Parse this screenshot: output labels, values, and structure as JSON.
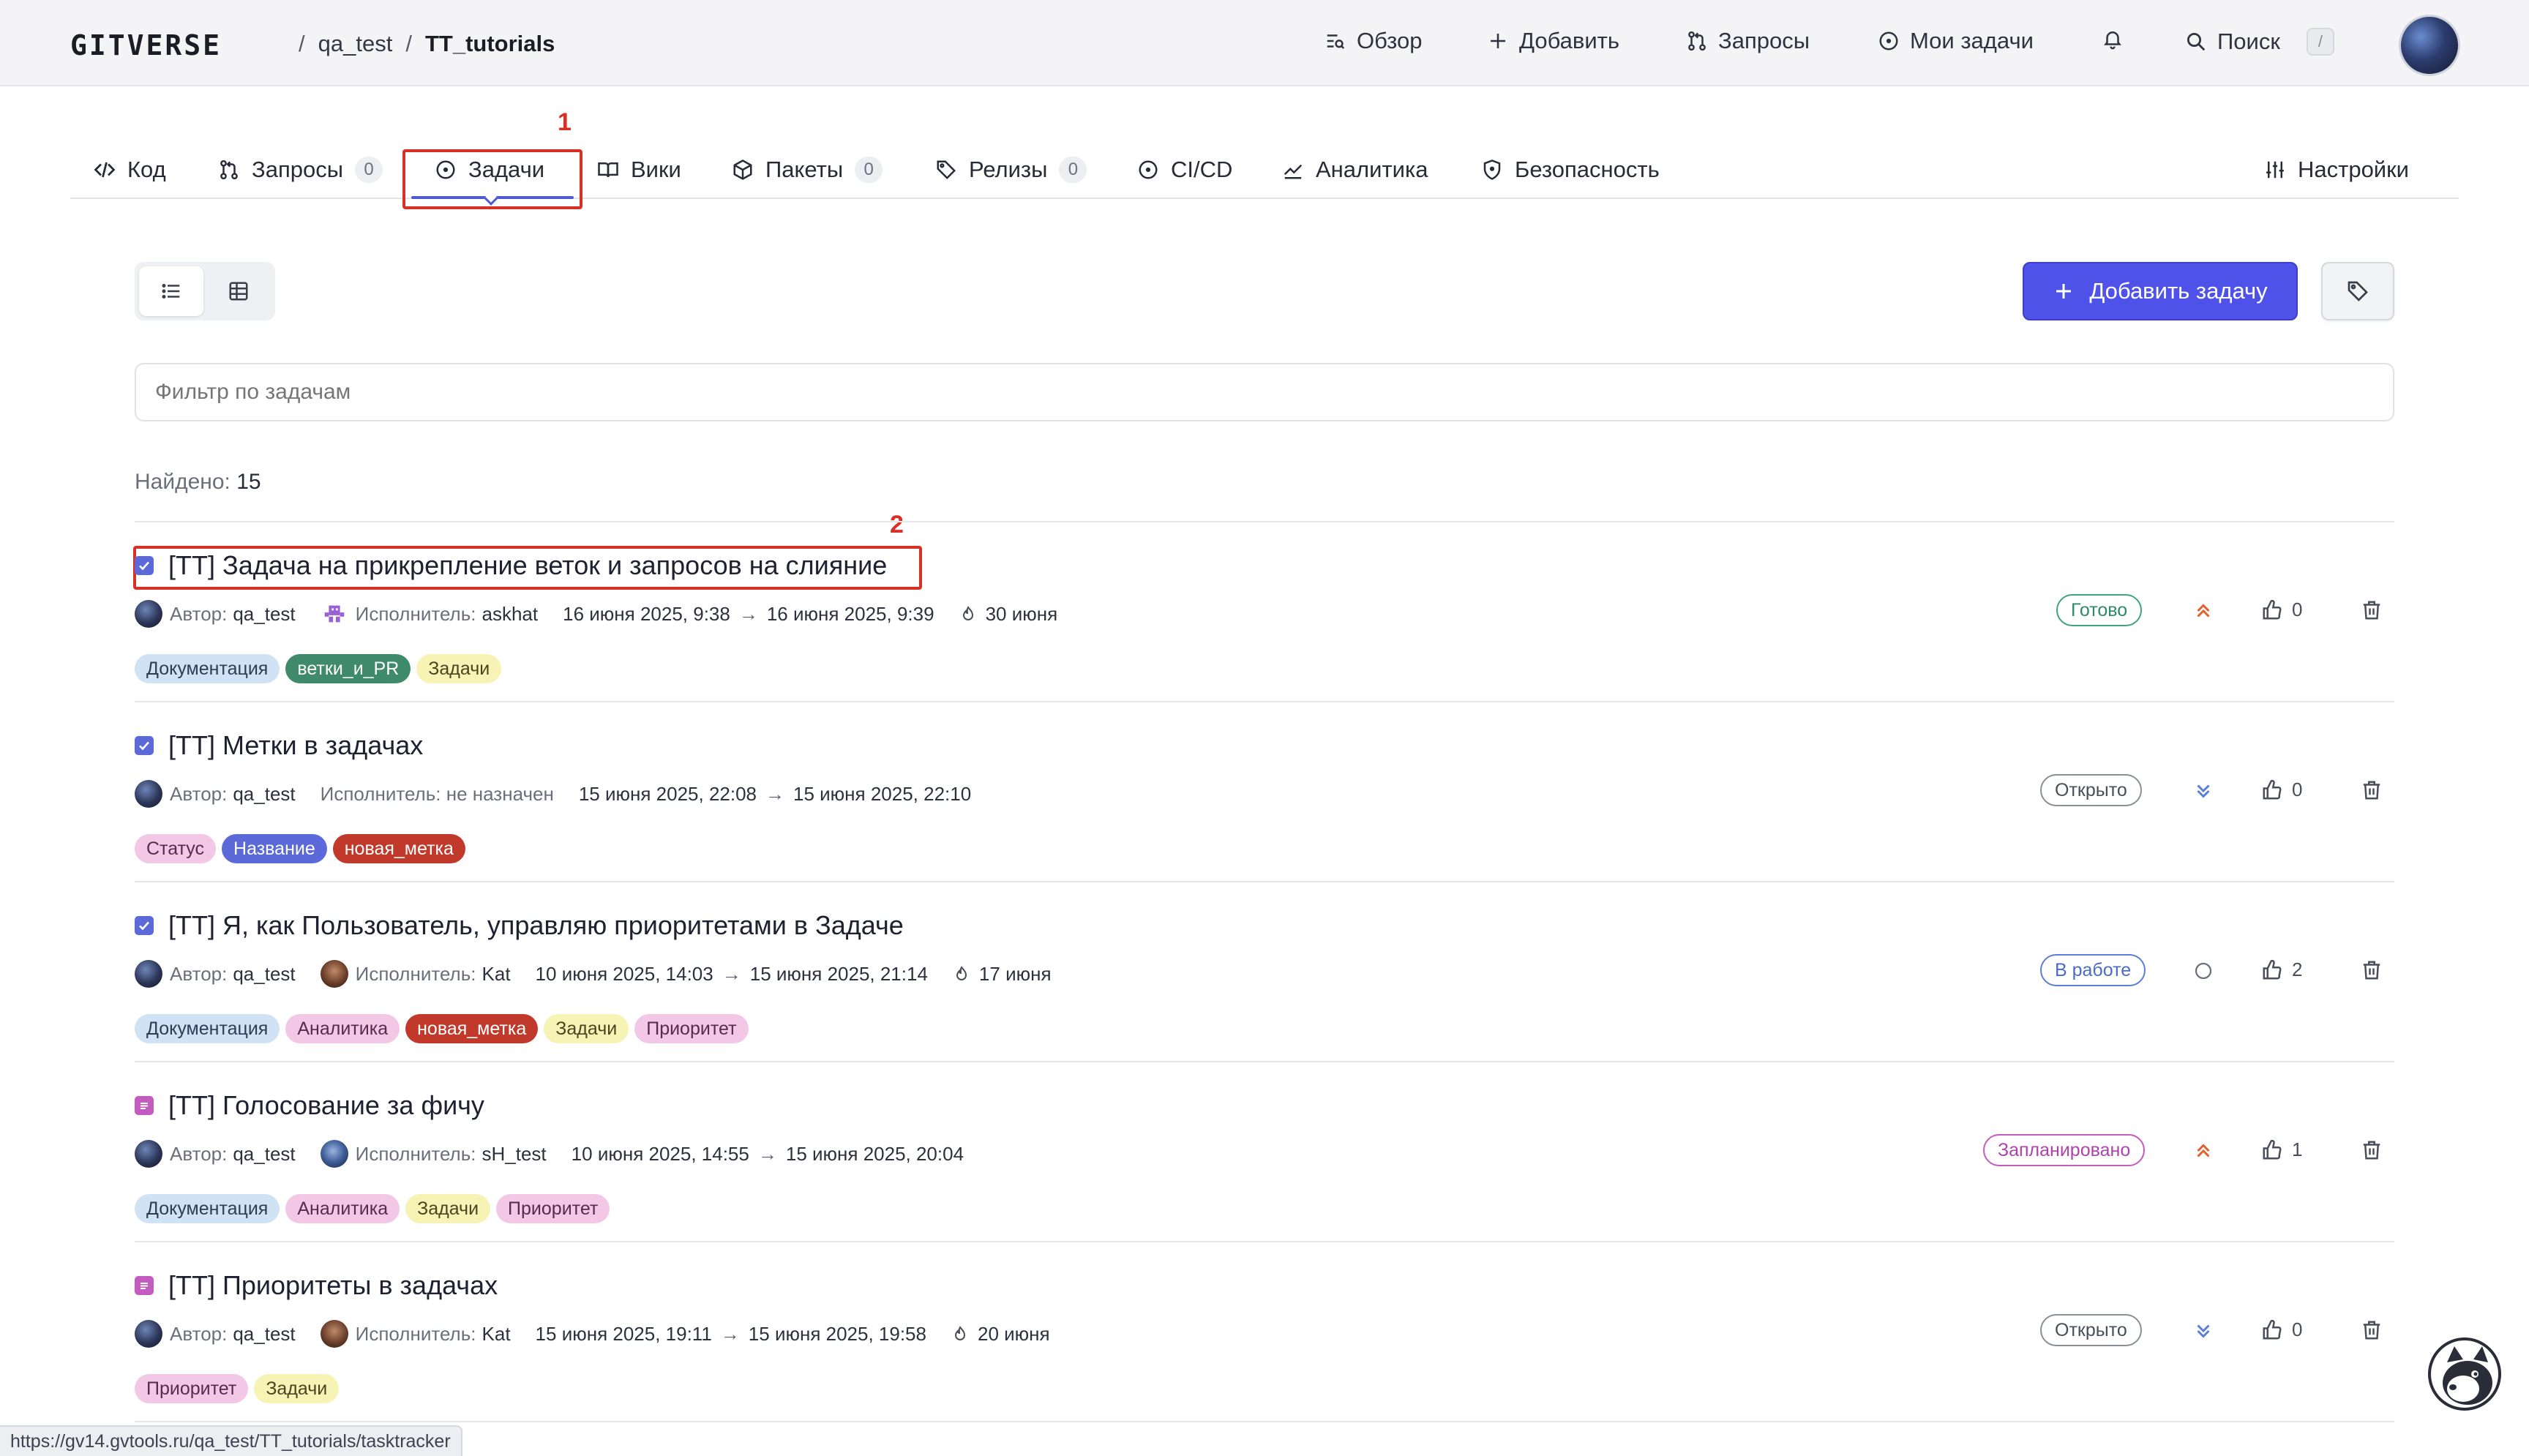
{
  "topbar": {
    "logo": "GITVERSE",
    "breadcrumb": {
      "owner": "qa_test",
      "repo": "TT_tutorials"
    },
    "nav": {
      "overview": "Обзор",
      "add": "Добавить",
      "requests": "Запросы",
      "my_tasks": "Мои задачи",
      "search": "Поиск",
      "search_shortcut": "/"
    }
  },
  "tabs": [
    {
      "label": "Код"
    },
    {
      "label": "Запросы",
      "count": "0"
    },
    {
      "label": "Задачи"
    },
    {
      "label": "Вики"
    },
    {
      "label": "Пакеты",
      "count": "0"
    },
    {
      "label": "Релизы",
      "count": "0"
    },
    {
      "label": "CI/CD"
    },
    {
      "label": "Аналитика"
    },
    {
      "label": "Безопасность"
    },
    {
      "label": "Настройки"
    }
  ],
  "annotations": {
    "first": "1",
    "second": "2"
  },
  "toolbar": {
    "add_task": "Добавить задачу",
    "filter_placeholder": "Фильтр по задачам"
  },
  "found": {
    "label": "Найдено:",
    "value": "15"
  },
  "meta_labels": {
    "author": "Автор:",
    "assignee": "Исполнитель:"
  },
  "issues": [
    {
      "title": "[TT] Задача на прикрепление веток и запросов на слияние",
      "type": "task",
      "author": "qa_test",
      "assignee": "askhat",
      "created": "16 июня 2025, 9:38",
      "updated": "16 июня 2025, 9:39",
      "due": "30 июня",
      "labels": [
        "Документация",
        "ветки_и_PR",
        "Задачи"
      ],
      "status": "Готово",
      "priority": "high",
      "likes": "0"
    },
    {
      "title": "[TT] Метки в задачах",
      "type": "task",
      "author": "qa_test",
      "assignee_text": "Исполнитель: не назначен",
      "created": "15 июня 2025, 22:08",
      "updated": "15 июня 2025, 22:10",
      "labels": [
        "Статус",
        "Название",
        "новая_метка"
      ],
      "status": "Открыто",
      "priority": "low",
      "likes": "0"
    },
    {
      "title": "[TT] Я, как Пользователь, управляю приоритетами в Задаче",
      "type": "task",
      "author": "qa_test",
      "assignee": "Kat",
      "created": "10 июня 2025, 14:03",
      "updated": "15 июня 2025, 21:14",
      "due": "17 июня",
      "labels": [
        "Документация",
        "Аналитика",
        "новая_метка",
        "Задачи",
        "Приоритет"
      ],
      "status": "В работе",
      "priority": "none",
      "likes": "2"
    },
    {
      "title": "[TT] Голосование за фичу",
      "type": "story",
      "author": "qa_test",
      "assignee": "sH_test",
      "created": "10 июня 2025, 14:55",
      "updated": "15 июня 2025, 20:04",
      "labels": [
        "Документация",
        "Аналитика",
        "Задачи",
        "Приоритет"
      ],
      "status": "Запланировано",
      "priority": "high",
      "likes": "1"
    },
    {
      "title": "[TT] Приоритеты в задачах",
      "type": "story",
      "author": "qa_test",
      "assignee": "Kat",
      "created": "15 июня 2025, 19:11",
      "updated": "15 июня 2025, 19:58",
      "due": "20 июня",
      "labels": [
        "Приоритет",
        "Задачи"
      ],
      "status": "Открыто",
      "priority": "low",
      "likes": "0"
    }
  ],
  "status_bar": {
    "url": "https://gv14.gvtools.ru/qa_test/TT_tutorials/tasktracker"
  },
  "colors": {
    "accent": "#4f52e8",
    "highlight": "#d93025",
    "label_documentation": "#cfe3f4",
    "label_branches": "#3f8a6a",
    "label_tasks": "#f6f3b5",
    "label_status": "#f2c8e6",
    "label_name": "#5b6ad8",
    "label_new": "#c0392b",
    "label_analytics": "#f2c8e6",
    "label_priority": "#f2c8e6"
  }
}
